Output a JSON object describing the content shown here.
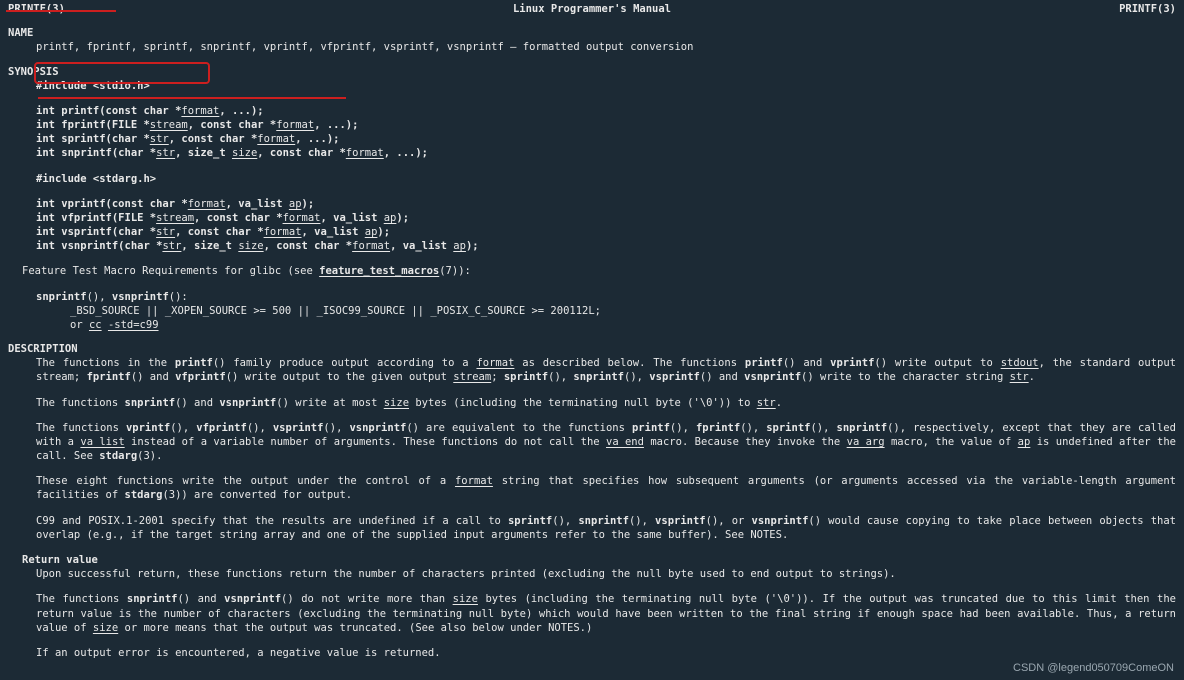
{
  "header": {
    "left": "PRINTF(3)",
    "center": "Linux Programmer's Manual",
    "right": "PRINTF(3)"
  },
  "name_section": {
    "title": "NAME",
    "line": "printf, fprintf, sprintf, snprintf, vprintf, vfprintf, vsprintf, vsnprintf – formatted output conversion"
  },
  "synopsis": {
    "title": "SYNOPSIS",
    "inc1": "#include <stdio.h>",
    "d_printf": {
      "pre": "int printf(const char *",
      "fmt": "format",
      "post": ", ...);"
    },
    "d_fprintf": {
      "pre": "int fprintf(FILE *",
      "stream": "stream",
      "mid": ", const char *",
      "fmt": "format",
      "post": ", ...);"
    },
    "d_sprintf": {
      "pre": "int sprintf(char *",
      "str": "str",
      "mid": ", const char *",
      "fmt": "format",
      "post": ", ...);"
    },
    "d_snprintf": {
      "pre": "int snprintf(char *",
      "str": "str",
      "mid1": ", size_t ",
      "size": "size",
      "mid2": ", const char *",
      "fmt": "format",
      "post": ", ...);"
    },
    "inc2": "#include <stdarg.h>",
    "d_vprintf": {
      "pre": "int vprintf(const char *",
      "fmt": "format",
      "mid": ", va_list ",
      "ap": "ap",
      "post": ");"
    },
    "d_vfprintf": {
      "pre": "int vfprintf(FILE *",
      "stream": "stream",
      "mid1": ", const char *",
      "fmt": "format",
      "mid2": ", va_list ",
      "ap": "ap",
      "post": ");"
    },
    "d_vsprintf": {
      "pre": "int vsprintf(char *",
      "str": "str",
      "mid1": ", const char *",
      "fmt": "format",
      "mid2": ", va_list ",
      "ap": "ap",
      "post": ");"
    },
    "d_vsnprintf": {
      "pre": "int vsnprintf(char *",
      "str": "str",
      "mid1": ", size_t ",
      "size": "size",
      "mid2": ", const char *",
      "fmt": "format",
      "mid3": ", va_list ",
      "ap": "ap",
      "post": ");"
    },
    "ftm_line_a": "Feature Test Macro Requirements for glibc (see ",
    "ftm_link": "feature_test_macros",
    "ftm_line_b": "(7)):",
    "ftm_funcs_a": "snprintf",
    "ftm_funcs_b": "(), ",
    "ftm_funcs_c": "vsnprintf",
    "ftm_funcs_d": "():",
    "ftm_req": "_BSD_SOURCE || _XOPEN_SOURCE >= 500 || _ISOC99_SOURCE || _POSIX_C_SOURCE >= 200112L;",
    "ftm_or_a": "or ",
    "ftm_or_b": "cc",
    "ftm_or_c": " ",
    "ftm_or_d": "-std=c99"
  },
  "description": {
    "title": "DESCRIPTION",
    "p1": {
      "a": "The  functions  in the ",
      "b": "printf",
      "c": "() family produce output according to a ",
      "d": "format",
      "e": " as described below.  The functions ",
      "f": "printf",
      "g": "() and ",
      "h": "vprintf",
      "i": "() write output to ",
      "j": "stdout",
      "k": ", the standard output stream; ",
      "l": "fprintf",
      "m": "() and ",
      "n": "vfprintf",
      "o": "() write output to the given output ",
      "p": "stream",
      "q": "; ",
      "r": "sprintf",
      "s": "(), ",
      "t": "snprintf",
      "u": "(), ",
      "v": "vsprintf",
      "w": "() and ",
      "x": "vsnprintf",
      "y": "() write to the character string ",
      "z": "str",
      "end": "."
    },
    "p2": {
      "a": "The functions ",
      "b": "snprintf",
      "c": "() and ",
      "d": "vsnprintf",
      "e": "() write at most ",
      "f": "size",
      "g": " bytes (including the terminating null byte ('\\0')) to ",
      "h": "str",
      "i": "."
    },
    "p3": {
      "a": "The functions ",
      "b": "vprintf",
      "c": "(), ",
      "d": "vfprintf",
      "e": "(), ",
      "f": "vsprintf",
      "g": "(), ",
      "h": "vsnprintf",
      "i": "() are equivalent to the functions ",
      "j": "printf",
      "k": "(), ",
      "l": "fprintf",
      "m": "(), ",
      "n": "sprintf",
      "o": "(), ",
      "p": "snprintf",
      "q": "(), respectively, except that they are called with a ",
      "r": "va_list",
      "s": " instead of a variable  number of arguments.  These functions do not call the ",
      "t": "va_end",
      "u": " macro.  Because they invoke the ",
      "v": "va_arg",
      "w": " macro, the value of ",
      "x": "ap",
      "y": " is undefined after the call.  See ",
      "z": "stdarg",
      "end": "(3)."
    },
    "p4": {
      "a": "These eight functions write the output under the control of a ",
      "b": "format",
      "c": " string that specifies how subsequent arguments (or arguments accessed via the variable-length argument facilities of ",
      "d": "stdarg",
      "e": "(3)) are converted for output."
    },
    "p5": {
      "a": "C99 and POSIX.1-2001 specify that the results are undefined if a call to ",
      "b": "sprintf",
      "c": "(), ",
      "d": "snprintf",
      "e": "(), ",
      "f": "vsprintf",
      "g": "(), or ",
      "h": "vsnprintf",
      "i": "() would cause copying to take place between objects that overlap (e.g., if the target string array and one of the supplied input arguments refer to the same buffer).  See NOTES."
    },
    "rv_title": "Return value",
    "rv1": "Upon successful return, these functions return the number of characters printed (excluding the null byte used to end output to strings).",
    "rv2": {
      "a": "The functions ",
      "b": "snprintf",
      "c": "() and ",
      "d": "vsnprintf",
      "e": "() do not write more than ",
      "f": "size",
      "g": " bytes (including the terminating null byte ('\\0')).  If the output was truncated due to this limit then the return  value  is  the  number  of  characters (excluding  the  terminating null byte) which would have been written to the final string if enough space had been available.  Thus, a return value of ",
      "h": "size",
      "i": " or more means that the output was truncated.  (See also below under NOTES.)"
    },
    "rv3": "If an output error is encountered, a negative value is returned."
  },
  "watermark": "CSDN @legend050709ComeON"
}
